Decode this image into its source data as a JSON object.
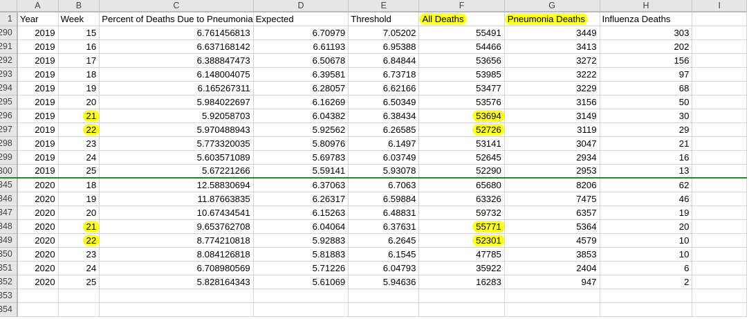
{
  "column_letters": [
    "A",
    "B",
    "C",
    "D",
    "E",
    "F",
    "G",
    "H",
    "I"
  ],
  "header_row": {
    "row_number": "1",
    "cells": [
      "Year",
      "Week",
      "Percent of Deaths Due to Pneumonia",
      "Expected",
      "Threshold",
      "All Deaths",
      "Pneumonia Deaths",
      "Influenza Deaths",
      ""
    ]
  },
  "highlight_color": "#ffff2b",
  "rows": [
    {
      "n": "290",
      "c": [
        "2019",
        "15",
        "6.761456813",
        "6.70979",
        "7.05202",
        "55491",
        "3449",
        "303"
      ]
    },
    {
      "n": "291",
      "c": [
        "2019",
        "16",
        "6.637168142",
        "6.61193",
        "6.95388",
        "54466",
        "3413",
        "202"
      ]
    },
    {
      "n": "292",
      "c": [
        "2019",
        "17",
        "6.388847473",
        "6.50678",
        "6.84844",
        "53656",
        "3272",
        "156"
      ]
    },
    {
      "n": "293",
      "c": [
        "2019",
        "18",
        "6.148004075",
        "6.39581",
        "6.73718",
        "53985",
        "3222",
        "97"
      ]
    },
    {
      "n": "294",
      "c": [
        "2019",
        "19",
        "6.165267311",
        "6.28057",
        "6.62166",
        "53477",
        "3229",
        "68"
      ]
    },
    {
      "n": "295",
      "c": [
        "2019",
        "20",
        "5.984022697",
        "6.16269",
        "6.50349",
        "53576",
        "3156",
        "50"
      ]
    },
    {
      "n": "296",
      "c": [
        "2019",
        "21",
        "5.92058703",
        "6.04382",
        "6.38434",
        "53694",
        "3149",
        "30"
      ]
    },
    {
      "n": "297",
      "c": [
        "2019",
        "22",
        "5.970488943",
        "5.92562",
        "6.26585",
        "52726",
        "3119",
        "29"
      ]
    },
    {
      "n": "298",
      "c": [
        "2019",
        "23",
        "5.773320035",
        "5.80976",
        "6.1497",
        "53141",
        "3047",
        "21"
      ]
    },
    {
      "n": "299",
      "c": [
        "2019",
        "24",
        "5.603571089",
        "5.69783",
        "6.03749",
        "52645",
        "2934",
        "16"
      ]
    },
    {
      "n": "300",
      "c": [
        "2019",
        "25",
        "5.67221266",
        "5.59141",
        "5.93078",
        "52290",
        "2953",
        "13"
      ]
    },
    {
      "n": "345",
      "c": [
        "2020",
        "18",
        "12.58830694",
        "6.37063",
        "6.7063",
        "65680",
        "8206",
        "62"
      ]
    },
    {
      "n": "346",
      "c": [
        "2020",
        "19",
        "11.87663835",
        "6.26317",
        "6.59884",
        "63326",
        "7475",
        "46"
      ]
    },
    {
      "n": "347",
      "c": [
        "2020",
        "20",
        "10.67434541",
        "6.15263",
        "6.48831",
        "59732",
        "6357",
        "19"
      ]
    },
    {
      "n": "348",
      "c": [
        "2020",
        "21",
        "9.653762708",
        "6.04064",
        "6.37631",
        "55771",
        "5364",
        "20"
      ]
    },
    {
      "n": "349",
      "c": [
        "2020",
        "22",
        "8.774210818",
        "5.92883",
        "6.2645",
        "52301",
        "4579",
        "10"
      ]
    },
    {
      "n": "350",
      "c": [
        "2020",
        "23",
        "8.084126818",
        "5.81883",
        "6.1545",
        "47785",
        "3853",
        "10"
      ]
    },
    {
      "n": "351",
      "c": [
        "2020",
        "24",
        "6.708980569",
        "5.71226",
        "6.04793",
        "35922",
        "2404",
        "6"
      ]
    },
    {
      "n": "352",
      "c": [
        "2020",
        "25",
        "5.828164343",
        "5.61069",
        "5.94636",
        "16283",
        "947",
        "2"
      ]
    }
  ],
  "empty_rows": [
    "353",
    "354"
  ]
}
